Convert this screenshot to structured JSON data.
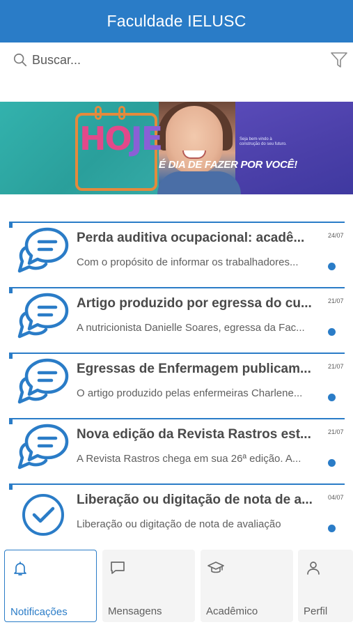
{
  "header": {
    "title": "Faculdade IELUSC"
  },
  "search": {
    "placeholder": "Buscar...",
    "value": ""
  },
  "banner": {
    "word_ho": "HO",
    "word_je": "JE",
    "slogan": "É DIA DE FAZER POR VOCÊ!",
    "small_text": "Seja bem-vindo à construção do seu futuro."
  },
  "notifications": [
    {
      "title": "Perda auditiva ocupacional: acadê...",
      "snippet": "Com o propósito de informar os trabalhadores...",
      "date": "24/07",
      "icon": "chat-bubbles-icon",
      "unread": true
    },
    {
      "title": "Artigo produzido por egressa do cu...",
      "snippet": "A nutricionista Danielle Soares, egressa da Fac...",
      "date": "21/07",
      "icon": "chat-bubbles-icon",
      "unread": true
    },
    {
      "title": "Egressas de Enfermagem publicam...",
      "snippet": "O artigo produzido pelas enfermeiras Charlene...",
      "date": "21/07",
      "icon": "chat-bubbles-icon",
      "unread": true
    },
    {
      "title": "Nova edição da Revista Rastros est...",
      "snippet": "A Revista Rastros chega em sua 26ª edição. A...",
      "date": "21/07",
      "icon": "chat-bubbles-icon",
      "unread": true
    },
    {
      "title": "Liberação ou digitação de nota de a...",
      "snippet": "Liberação ou digitação de nota de avaliação",
      "date": "04/07",
      "icon": "check-circle-icon",
      "unread": true
    }
  ],
  "tabs": [
    {
      "label": "Notificações",
      "icon": "bell-icon",
      "active": true
    },
    {
      "label": "Mensagens",
      "icon": "message-icon",
      "active": false
    },
    {
      "label": "Acadêmico",
      "icon": "graduation-cap-icon",
      "active": false
    },
    {
      "label": "Perfil",
      "icon": "user-icon",
      "active": false
    }
  ],
  "colors": {
    "primary": "#2a7cc7",
    "text": "#4a4a4a"
  }
}
